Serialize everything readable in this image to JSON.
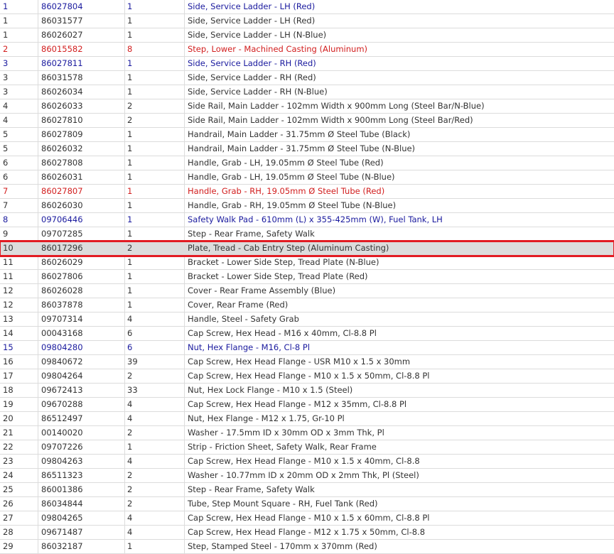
{
  "selected_index": 17,
  "rows": [
    {
      "item": "1",
      "part": "86027804",
      "qty": "1",
      "desc": "Side, Service Ladder - LH (Red)",
      "color": "blue"
    },
    {
      "item": "1",
      "part": "86031577",
      "qty": "1",
      "desc": "Side, Service Ladder - LH (Red)",
      "color": "normal"
    },
    {
      "item": "1",
      "part": "86026027",
      "qty": "1",
      "desc": "Side, Service Ladder - LH (N-Blue)",
      "color": "normal"
    },
    {
      "item": "2",
      "part": "86015582",
      "qty": "8",
      "desc": "Step, Lower - Machined Casting (Aluminum)",
      "color": "red"
    },
    {
      "item": "3",
      "part": "86027811",
      "qty": "1",
      "desc": "Side, Service Ladder - RH (Red)",
      "color": "blue"
    },
    {
      "item": "3",
      "part": "86031578",
      "qty": "1",
      "desc": "Side, Service Ladder - RH (Red)",
      "color": "normal"
    },
    {
      "item": "3",
      "part": "86026034",
      "qty": "1",
      "desc": "Side, Service Ladder - RH (N-Blue)",
      "color": "normal"
    },
    {
      "item": "4",
      "part": "86026033",
      "qty": "2",
      "desc": "Side Rail, Main Ladder - 102mm Width x 900mm Long (Steel Bar/N-Blue)",
      "color": "normal"
    },
    {
      "item": "4",
      "part": "86027810",
      "qty": "2",
      "desc": "Side Rail, Main Ladder - 102mm Width x 900mm Long (Steel Bar/Red)",
      "color": "normal"
    },
    {
      "item": "5",
      "part": "86027809",
      "qty": "1",
      "desc": "Handrail, Main Ladder - 31.75mm Ø Steel Tube (Black)",
      "color": "normal"
    },
    {
      "item": "5",
      "part": "86026032",
      "qty": "1",
      "desc": "Handrail, Main Ladder - 31.75mm Ø Steel Tube (N-Blue)",
      "color": "normal"
    },
    {
      "item": "6",
      "part": "86027808",
      "qty": "1",
      "desc": "Handle, Grab - LH, 19.05mm Ø Steel Tube (Red)",
      "color": "normal"
    },
    {
      "item": "6",
      "part": "86026031",
      "qty": "1",
      "desc": "Handle, Grab - LH, 19.05mm Ø Steel Tube (N-Blue)",
      "color": "normal"
    },
    {
      "item": "7",
      "part": "86027807",
      "qty": "1",
      "desc": "Handle, Grab - RH, 19.05mm Ø Steel Tube (Red)",
      "color": "red"
    },
    {
      "item": "7",
      "part": "86026030",
      "qty": "1",
      "desc": "Handle, Grab - RH, 19.05mm Ø Steel Tube (N-Blue)",
      "color": "normal"
    },
    {
      "item": "8",
      "part": "09706446",
      "qty": "1",
      "desc": "Safety Walk Pad - 610mm (L) x 355-425mm (W), Fuel Tank, LH",
      "color": "blue"
    },
    {
      "item": "9",
      "part": "09707285",
      "qty": "1",
      "desc": "Step - Rear Frame, Safety Walk",
      "color": "normal"
    },
    {
      "item": "10",
      "part": "86017296",
      "qty": "2",
      "desc": "Plate, Tread - Cab Entry Step (Aluminum Casting)",
      "color": "normal"
    },
    {
      "item": "11",
      "part": "86026029",
      "qty": "1",
      "desc": "Bracket - Lower Side Step, Tread Plate (N-Blue)",
      "color": "normal"
    },
    {
      "item": "11",
      "part": "86027806",
      "qty": "1",
      "desc": "Bracket - Lower Side Step, Tread Plate (Red)",
      "color": "normal"
    },
    {
      "item": "12",
      "part": "86026028",
      "qty": "1",
      "desc": "Cover - Rear Frame Assembly (Blue)",
      "color": "normal"
    },
    {
      "item": "12",
      "part": "86037878",
      "qty": "1",
      "desc": "Cover, Rear Frame (Red)",
      "color": "normal"
    },
    {
      "item": "13",
      "part": "09707314",
      "qty": "4",
      "desc": "Handle, Steel - Safety Grab",
      "color": "normal"
    },
    {
      "item": "14",
      "part": "00043168",
      "qty": "6",
      "desc": "Cap Screw, Hex Head - M16 x 40mm, Cl-8.8 Pl",
      "color": "normal"
    },
    {
      "item": "15",
      "part": "09804280",
      "qty": "6",
      "desc": "Nut, Hex Flange - M16, Cl-8 Pl",
      "color": "blue"
    },
    {
      "item": "16",
      "part": "09840672",
      "qty": "39",
      "desc": "Cap Screw, Hex Head Flange - USR M10 x 1.5 x 30mm",
      "color": "normal"
    },
    {
      "item": "17",
      "part": "09804264",
      "qty": "2",
      "desc": "Cap Screw, Hex Head Flange - M10 x 1.5 x 50mm, Cl-8.8 Pl",
      "color": "normal"
    },
    {
      "item": "18",
      "part": "09672413",
      "qty": "33",
      "desc": "Nut, Hex Lock Flange - M10 x 1.5 (Steel)",
      "color": "normal"
    },
    {
      "item": "19",
      "part": "09670288",
      "qty": "4",
      "desc": "Cap Screw, Hex Head Flange - M12 x 35mm, Cl-8.8 Pl",
      "color": "normal"
    },
    {
      "item": "20",
      "part": "86512497",
      "qty": "4",
      "desc": "Nut, Hex Flange - M12 x 1.75, Gr-10 Pl",
      "color": "normal"
    },
    {
      "item": "21",
      "part": "00140020",
      "qty": "2",
      "desc": "Washer - 17.5mm ID x 30mm OD x 3mm Thk, Pl",
      "color": "normal"
    },
    {
      "item": "22",
      "part": "09707226",
      "qty": "1",
      "desc": "Strip - Friction Sheet, Safety Walk, Rear Frame",
      "color": "normal"
    },
    {
      "item": "23",
      "part": "09804263",
      "qty": "4",
      "desc": "Cap Screw, Hex Head Flange - M10 x 1.5 x 40mm, Cl-8.8",
      "color": "normal"
    },
    {
      "item": "24",
      "part": "86511323",
      "qty": "2",
      "desc": "Washer - 10.77mm ID x 20mm OD x 2mm Thk, Pl (Steel)",
      "color": "normal"
    },
    {
      "item": "25",
      "part": "86001386",
      "qty": "2",
      "desc": "Step - Rear Frame, Safety Walk",
      "color": "normal"
    },
    {
      "item": "26",
      "part": "86034844",
      "qty": "2",
      "desc": "Tube, Step Mount Square - RH, Fuel Tank (Red)",
      "color": "normal"
    },
    {
      "item": "27",
      "part": "09804265",
      "qty": "4",
      "desc": "Cap Screw, Hex Head Flange - M10 x 1.5 x 60mm, Cl-8.8 Pl",
      "color": "normal"
    },
    {
      "item": "28",
      "part": "09671487",
      "qty": "4",
      "desc": "Cap Screw, Hex Head Flange - M12 x 1.75 x 50mm, Cl-8.8",
      "color": "normal"
    },
    {
      "item": "29",
      "part": "86032187",
      "qty": "1",
      "desc": "Step, Stamped Steel - 170mm x 370mm (Red)",
      "color": "normal"
    }
  ]
}
